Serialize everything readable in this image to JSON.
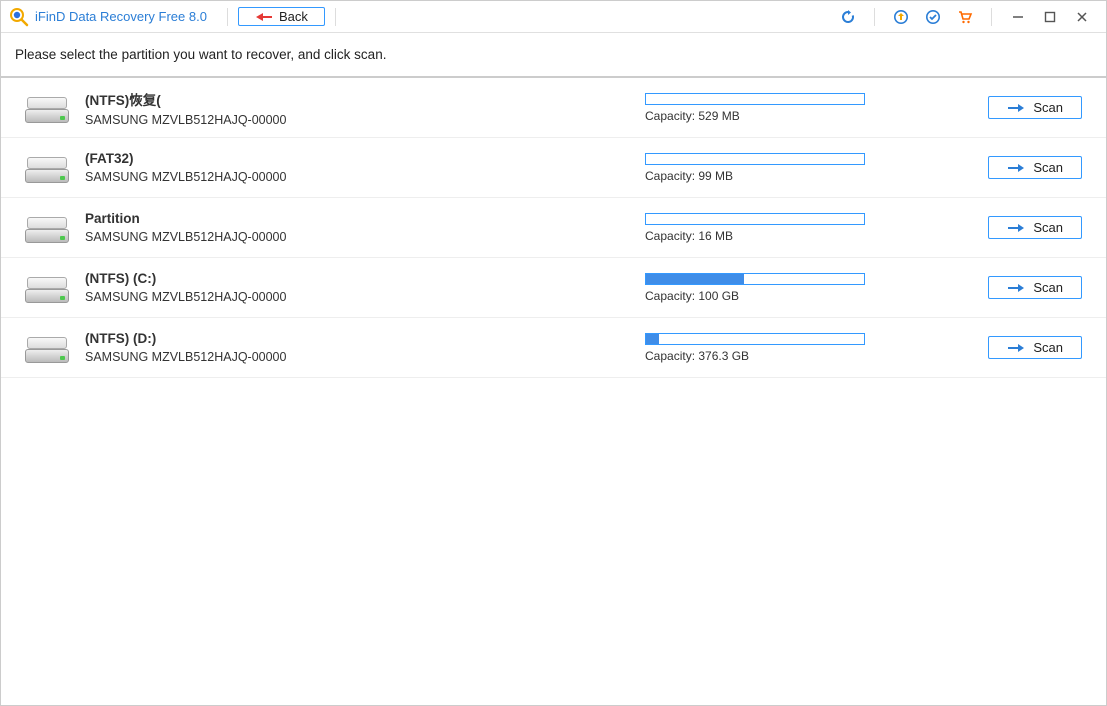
{
  "header": {
    "app_title": "iFinD Data Recovery Free 8.0",
    "back_label": "Back"
  },
  "instruction": "Please select the partition you want to recover, and click scan.",
  "scan_label": "Scan",
  "capacity_prefix": "Capacity: ",
  "partitions": [
    {
      "name": "(NTFS)恢复(",
      "device": "SAMSUNG MZVLB512HAJQ-00000",
      "capacity": "529 MB",
      "fill_pct": 0
    },
    {
      "name": "(FAT32)",
      "device": "SAMSUNG MZVLB512HAJQ-00000",
      "capacity": "99 MB",
      "fill_pct": 0
    },
    {
      "name": "Partition",
      "device": "SAMSUNG MZVLB512HAJQ-00000",
      "capacity": "16 MB",
      "fill_pct": 0
    },
    {
      "name": "(NTFS) (C:)",
      "device": "SAMSUNG MZVLB512HAJQ-00000",
      "capacity": "100 GB",
      "fill_pct": 45
    },
    {
      "name": "(NTFS) (D:)",
      "device": "SAMSUNG MZVLB512HAJQ-00000",
      "capacity": "376.3 GB",
      "fill_pct": 6
    }
  ]
}
